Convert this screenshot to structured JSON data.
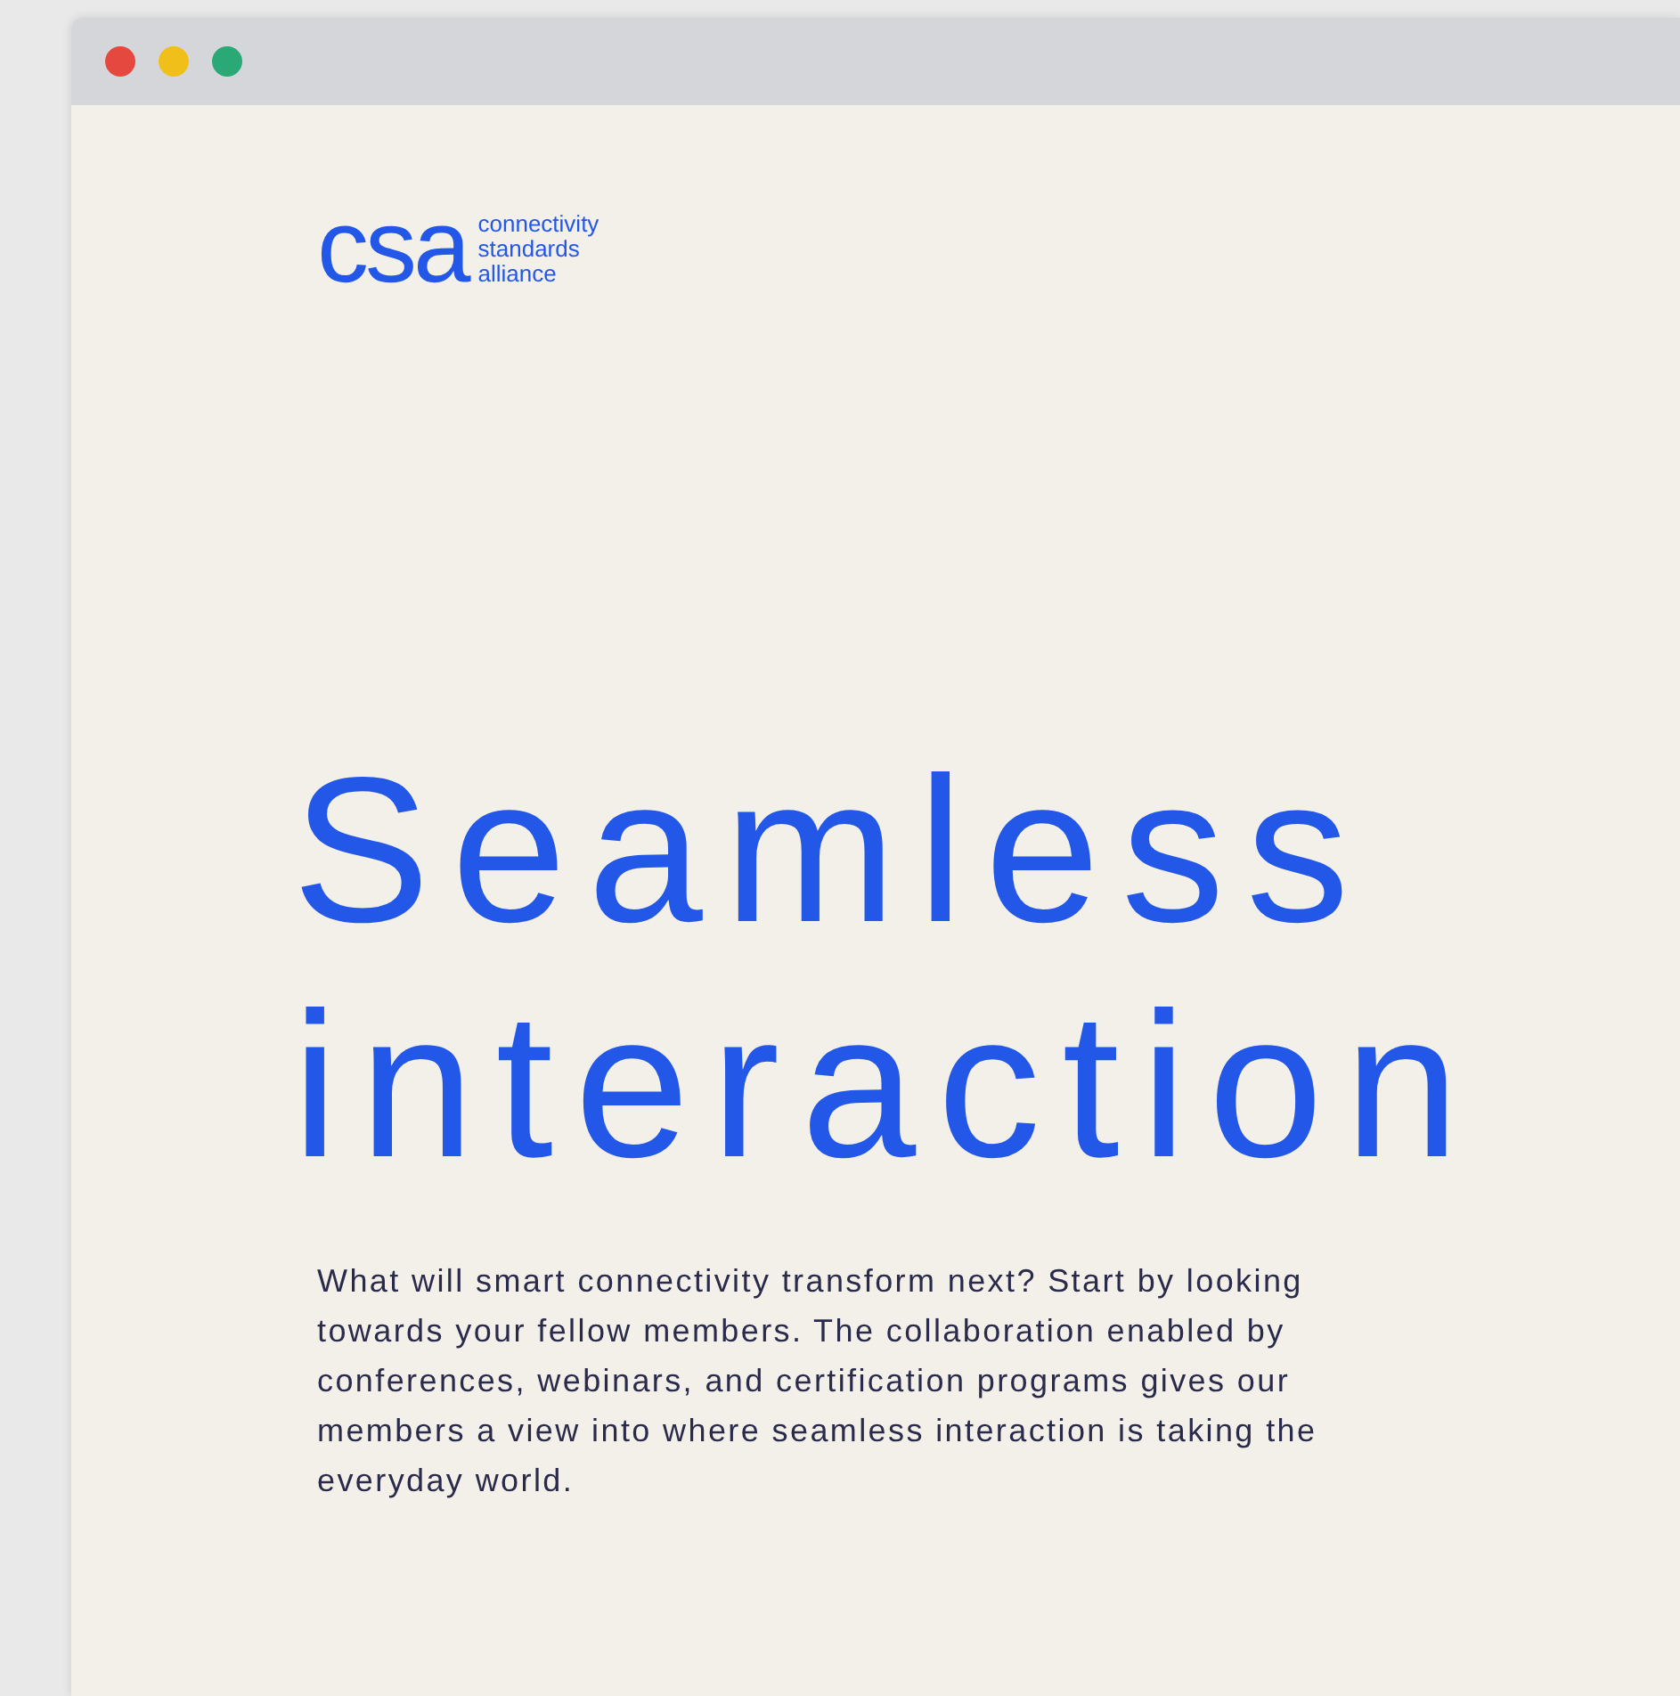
{
  "window": {
    "controls": [
      {
        "color": "#e5483f"
      },
      {
        "color": "#f0bf1a"
      },
      {
        "color": "#2aa876"
      }
    ]
  },
  "logo": {
    "mark": "csa",
    "tagline": [
      "connectivity",
      "standards",
      "alliance"
    ]
  },
  "hero": {
    "heading": [
      "Seamless",
      "interaction"
    ],
    "body": "What will smart connectivity transform next? Start by looking towards your fellow members. The collaboration enabled by conferences, webinars, and certification programs gives our members a view into where seamless interaction is taking the everyday world."
  }
}
